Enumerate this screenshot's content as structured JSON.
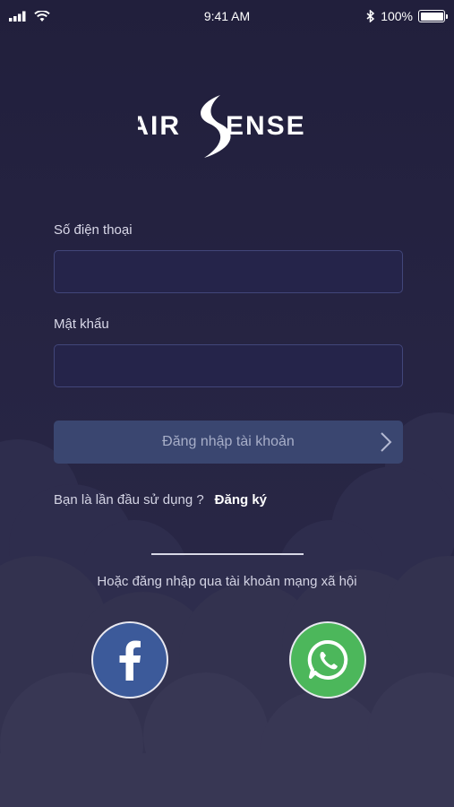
{
  "status_bar": {
    "time": "9:41 AM",
    "battery_text": "100%",
    "battery_level": 1.0,
    "icons": [
      "signal-icon",
      "wifi-icon",
      "bluetooth-icon",
      "battery-icon"
    ]
  },
  "logo": {
    "text_left": "AIR",
    "text_right": "ENSE",
    "brand_initial": "S"
  },
  "form": {
    "phone_label": "Số điện thoại",
    "phone_value": "",
    "password_label": "Mật khẩu",
    "password_value": "",
    "login_label": "Đăng nhập tài khoản"
  },
  "signup": {
    "prompt": "Bạn là lần đầu sử dụng ?",
    "link": "Đăng ký"
  },
  "social": {
    "prompt": "Hoặc đăng nhập qua tài khoản mạng xã hội",
    "facebook_icon": "facebook-icon",
    "whatsapp_icon": "whatsapp-icon"
  },
  "colors": {
    "background": "#242240",
    "input_border": "#42467a",
    "button_bg": "#3a4670",
    "facebook": "#3c5a9a",
    "whatsapp": "#4cb75b"
  }
}
